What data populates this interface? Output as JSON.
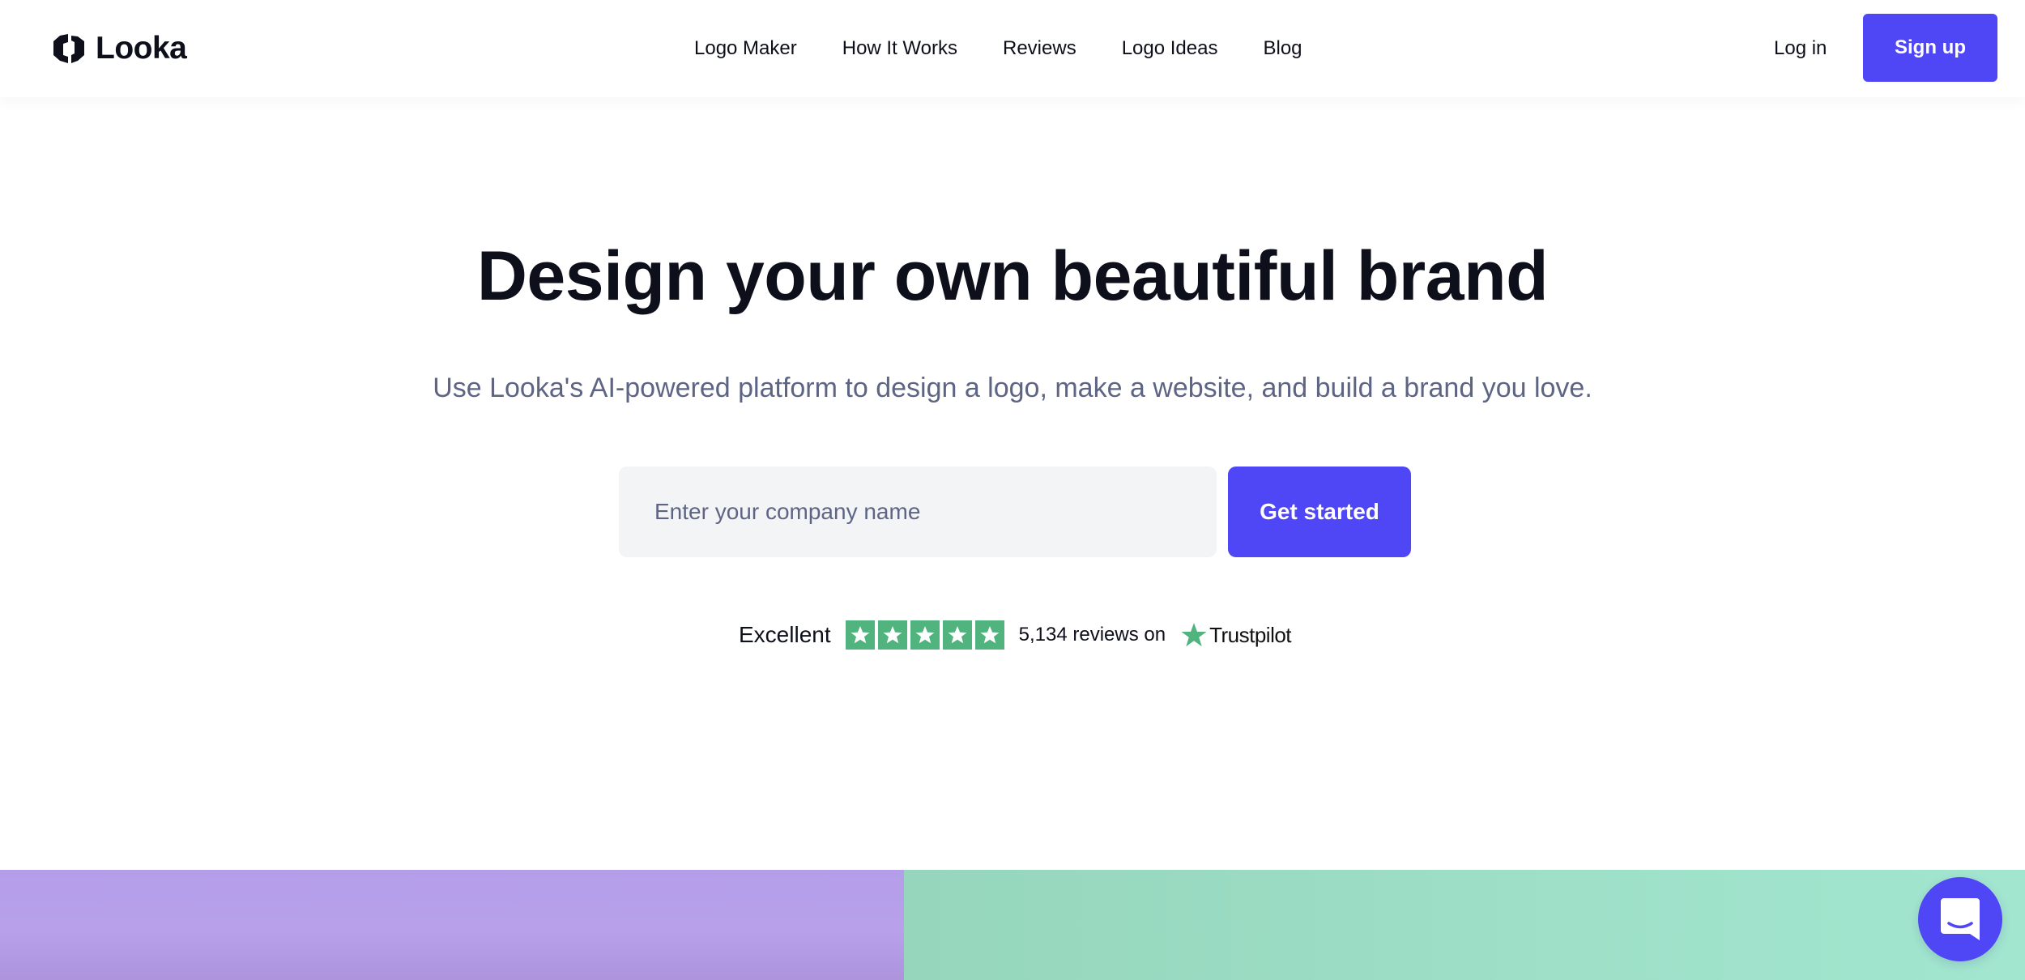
{
  "brand": {
    "name": "Looka",
    "logo_icon": "looka-hexagon-logo-icon",
    "accent_color": "#4f46f5"
  },
  "nav": {
    "items": [
      {
        "label": "Logo Maker"
      },
      {
        "label": "How It Works"
      },
      {
        "label": "Reviews"
      },
      {
        "label": "Logo Ideas"
      },
      {
        "label": "Blog"
      }
    ],
    "login_label": "Log in",
    "signup_label": "Sign up"
  },
  "hero": {
    "title": "Design your own beautiful brand",
    "subtitle": "Use Looka's AI-powered platform to design a logo, make a website, and build a brand you love.",
    "input": {
      "value": "",
      "placeholder": "Enter your company name"
    },
    "cta_label": "Get started"
  },
  "trustpilot": {
    "rating_label": "Excellent",
    "stars": 5,
    "stars_max": 5,
    "review_text": "5,134 reviews on",
    "brand": "Trustpilot",
    "star_color": "#51b47f"
  },
  "showcase": {
    "panel_colors": [
      "#b59ee9",
      "#9ad9c2"
    ]
  },
  "chat": {
    "icon": "chat-bubble-smile-icon"
  }
}
